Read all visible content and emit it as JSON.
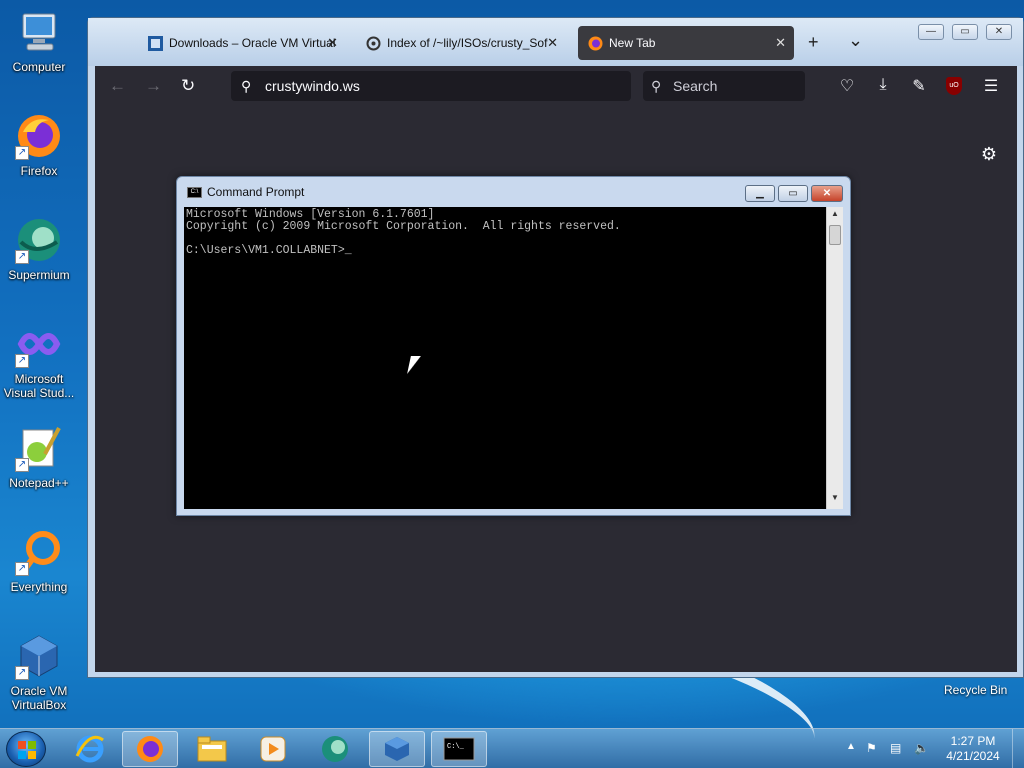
{
  "desktop": {
    "icons": [
      {
        "label": "Computer",
        "icon": "computer-icon"
      },
      {
        "label": "Firefox",
        "icon": "firefox-icon"
      },
      {
        "label": "Supermium",
        "icon": "supermium-icon"
      },
      {
        "label": "Microsoft Visual Stud...",
        "icon": "visual-studio-icon"
      },
      {
        "label": "Notepad++",
        "icon": "notepadpp-icon"
      },
      {
        "label": "Everything",
        "icon": "everything-icon"
      },
      {
        "label": "Oracle VM VirtualBox",
        "icon": "virtualbox-icon"
      }
    ],
    "recycle_bin": "Recycle Bin"
  },
  "firefox": {
    "tabs": [
      {
        "title": "Downloads – Oracle VM Virtual",
        "icon": "virtualbox-favicon",
        "active": false
      },
      {
        "title": "Index of /~lily/ISOs/crusty_Sof",
        "icon": "page-favicon",
        "active": false
      },
      {
        "title": "New Tab",
        "icon": "firefox-favicon",
        "active": true
      }
    ],
    "new_tab_glyph": "+",
    "tab_list_glyph": "⌄",
    "window_controls": {
      "minimize": "—",
      "maximize": "▭",
      "close": "✕"
    },
    "nav": {
      "back": "←",
      "forward": "→",
      "reload": "↻"
    },
    "url": "crustywindo.ws",
    "search_placeholder": "Search",
    "toolbar_icons": [
      "pocket-icon",
      "downloads-icon",
      "extensions-icon",
      "ublock-icon",
      "menu-icon"
    ],
    "ublock_badge": "uO"
  },
  "cmd": {
    "title": "Command Prompt",
    "icon_text": "C:\\",
    "lines": [
      "Microsoft Windows [Version 6.1.7601]",
      "Copyright (c) 2009 Microsoft Corporation.  All rights reserved.",
      "",
      "C:\\Users\\VM1.COLLABNET>_"
    ],
    "controls": {
      "minimize": "▁",
      "maximize": "▭",
      "close": "✕"
    }
  },
  "taskbar": {
    "pinned": [
      "ie-icon",
      "firefox-icon",
      "explorer-icon",
      "media-player-icon",
      "supermium-icon",
      "virtualbox-icon",
      "cmd-icon"
    ],
    "tray_icons": [
      "show-hidden-icon",
      "action-center-flag-icon",
      "network-icon",
      "volume-muted-icon"
    ],
    "time": "1:27 PM",
    "date": "4/21/2024"
  }
}
